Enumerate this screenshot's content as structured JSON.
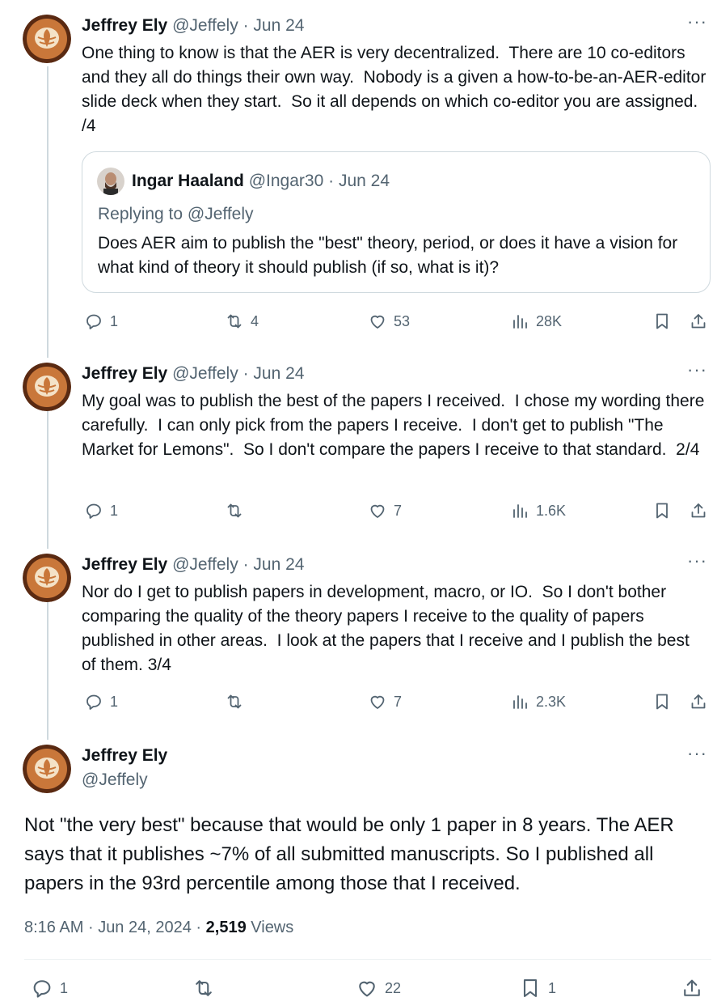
{
  "tweets": [
    {
      "name": "Jeffrey Ely",
      "handle": "@Jeffely",
      "sep": "·",
      "date": "Jun 24",
      "more": "···",
      "text": "One thing to know is that the AER is very decentralized.  There are 10 co-editors and they all do things their own way.  Nobody is a given a how-to-be-an-AER-editor slide deck when they start.  So it all depends on which co-editor you are assigned.  /4",
      "quote": {
        "name": "Ingar Haaland",
        "handle": "@Ingar30",
        "sep": "·",
        "date": "Jun 24",
        "replying": "Replying to @Jeffely",
        "text": "Does AER aim to publish the \"best\" theory, period, or does it have a vision for what kind of theory it should publish (if so, what is it)?"
      },
      "stats": {
        "replies": "1",
        "reposts": "4",
        "likes": "53",
        "views": "28K"
      }
    },
    {
      "name": "Jeffrey Ely",
      "handle": "@Jeffely",
      "sep": "·",
      "date": "Jun 24",
      "more": "···",
      "text": "My goal was to publish the best of the papers I received.  I chose my wording there carefully.  I can only pick from the papers I receive.  I don't get to publish \"The Market for Lemons\".  So I don't compare the papers I receive to that standard.  2/4",
      "stats": {
        "replies": "1",
        "reposts": "",
        "likes": "7",
        "views": "1.6K"
      }
    },
    {
      "name": "Jeffrey Ely",
      "handle": "@Jeffely",
      "sep": "·",
      "date": "Jun 24",
      "more": "···",
      "text": "Nor do I get to publish papers in development, macro, or IO.  So I don't bother comparing the quality of the theory papers I receive to the quality of papers published in other areas.  I look at the papers that I receive and I publish the best of them. 3/4",
      "stats": {
        "replies": "1",
        "reposts": "",
        "likes": "7",
        "views": "2.3K"
      }
    }
  ],
  "main": {
    "name": "Jeffrey Ely",
    "handle": "@Jeffely",
    "more": "···",
    "text": "Not \"the very best\" because that would be only 1 paper in 8 years.  The AER says that it publishes ~7% of all submitted manuscripts.  So I published all papers in the 93rd percentile among those that I received.",
    "time": "8:16 AM",
    "sep": "·",
    "date": "Jun 24, 2024",
    "views_count": "2,519",
    "views_label": "Views",
    "stats": {
      "replies": "1",
      "reposts": "",
      "likes": "22",
      "bookmarks": "1"
    }
  },
  "icons": [
    "reply-icon",
    "repost-icon",
    "like-icon",
    "views-icon",
    "bookmark-icon",
    "share-icon",
    "more-icon"
  ],
  "colors": {
    "text": "#0f1419",
    "secondary": "#536471",
    "border": "#cfd9de"
  }
}
